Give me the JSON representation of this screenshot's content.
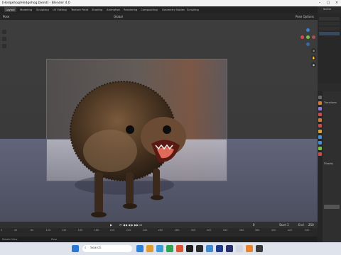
{
  "window": {
    "title": "[Hedgehog\\Hedgehog.blend] - Blender 4.0"
  },
  "workspaces": [
    "Layout",
    "Modeling",
    "Sculpting",
    "UV Editing",
    "Texture Paint",
    "Shading",
    "Animation",
    "Rendering",
    "Compositing",
    "Geometry Nodes",
    "Scripting"
  ],
  "header": {
    "object_mode": "Pose",
    "orientation": "Global",
    "overlays_label": "Pose Options"
  },
  "scene": {
    "label": "Scene"
  },
  "timeline": {
    "ruler": [
      "0",
      "40",
      "80",
      "120",
      "140",
      "160",
      "180",
      "200",
      "220",
      "240",
      "260",
      "280",
      "300",
      "320",
      "340",
      "360",
      "380",
      "400",
      "420",
      "440"
    ],
    "current_frame": "0",
    "start_label": "Start",
    "start_value": "1",
    "end_label": "End",
    "end_value": "250"
  },
  "status": {
    "left": "Rotate View",
    "center": "Pose"
  },
  "properties": {
    "label1": "Transform",
    "label2": "Display"
  },
  "taskbar": {
    "search_placeholder": "Search"
  },
  "colors": {
    "accent_blue": "#4a8fd6",
    "active_tab": "#3c3c3c",
    "x_axis": "#d84a4a",
    "y_axis": "#7ac143",
    "z_axis": "#3d7fd1"
  },
  "icons": [
    "blender-icon",
    "search-icon",
    "camera-icon",
    "hand-icon",
    "zoom-icon",
    "play-icon",
    "windows-start-icon"
  ]
}
